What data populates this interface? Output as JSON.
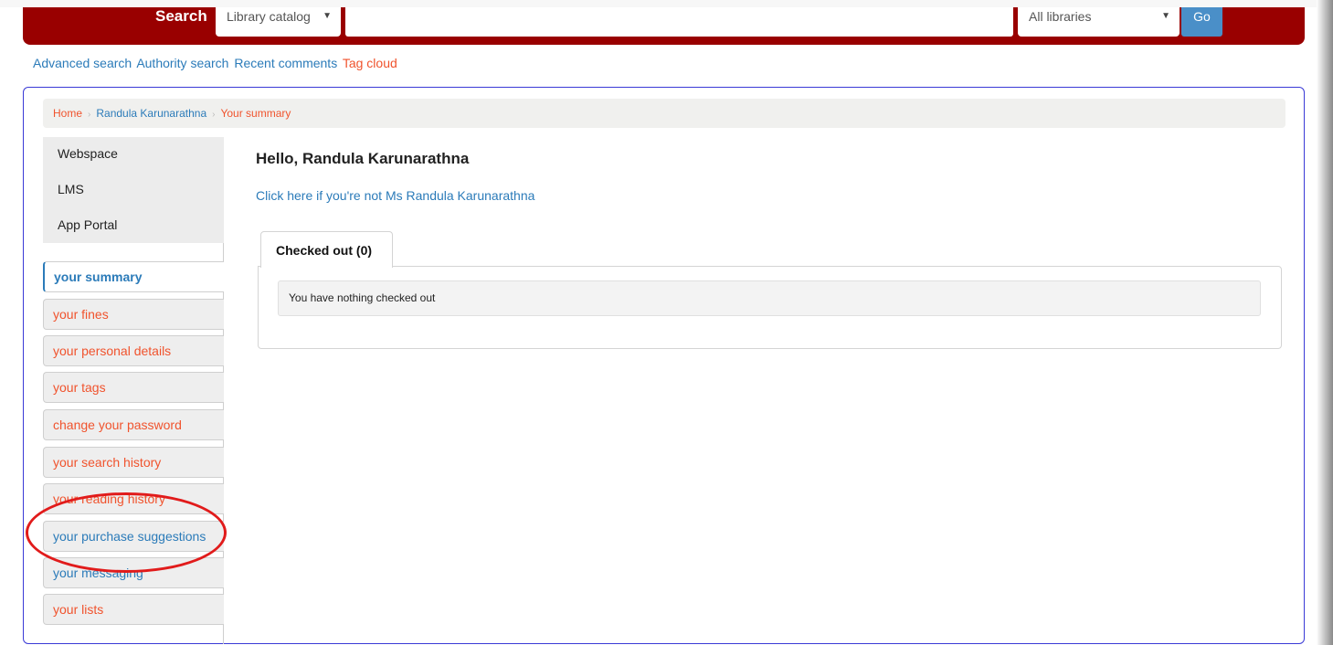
{
  "header": {
    "search_label": "Search",
    "catalog_select": "Library catalog",
    "search_value": "",
    "libraries_select": "All libraries",
    "go_label": "Go"
  },
  "moresearches": {
    "advanced": "Advanced search",
    "authority": "Authority search",
    "recent": "Recent comments",
    "tagcloud": "Tag cloud"
  },
  "breadcrumb": {
    "home": "Home",
    "user": "Randula Karunarathna",
    "current": "Your summary"
  },
  "quicklinks": {
    "items": [
      "Webspace",
      "LMS",
      "App Portal"
    ]
  },
  "usermenu": {
    "items": [
      {
        "label": "your summary"
      },
      {
        "label": "your fines"
      },
      {
        "label": "your personal details"
      },
      {
        "label": "your tags"
      },
      {
        "label": "change your password"
      },
      {
        "label": "your search history"
      },
      {
        "label": "your reading history"
      },
      {
        "label": "your purchase suggestions"
      },
      {
        "label": "your messaging"
      },
      {
        "label": "your lists"
      }
    ]
  },
  "content": {
    "greeting": "Hello, Randula Karunarathna",
    "not_me": "Click here if you're not Ms Randula Karunarathna",
    "tab_checked_out": "Checked out (0)",
    "nothing_checked_out": "You have nothing checked out"
  },
  "colors": {
    "header_bg": "#990000",
    "link_blue": "#2b7bb9",
    "link_orange": "#f0532d",
    "go_button": "#4a8fc8",
    "highlight_ellipse": "#e11b1b"
  }
}
